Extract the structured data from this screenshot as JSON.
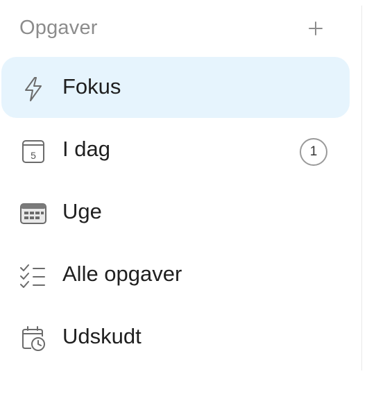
{
  "section": {
    "title": "Opgaver",
    "add_label": "+"
  },
  "nav": {
    "items": [
      {
        "label": "Fokus",
        "icon": "lightning-icon",
        "active": true
      },
      {
        "label": "I dag",
        "icon": "calendar-day-icon",
        "calendar_day": "5",
        "count": "1"
      },
      {
        "label": "Uge",
        "icon": "calendar-week-icon"
      },
      {
        "label": "Alle opgaver",
        "icon": "checklist-icon"
      },
      {
        "label": "Udskudt",
        "icon": "calendar-clock-icon"
      }
    ]
  },
  "colors": {
    "active_background": "#e6f4fd",
    "header_text": "#8c8c8c",
    "label_text": "#1f1f1f",
    "icon_stroke": "#6b6b6b"
  }
}
